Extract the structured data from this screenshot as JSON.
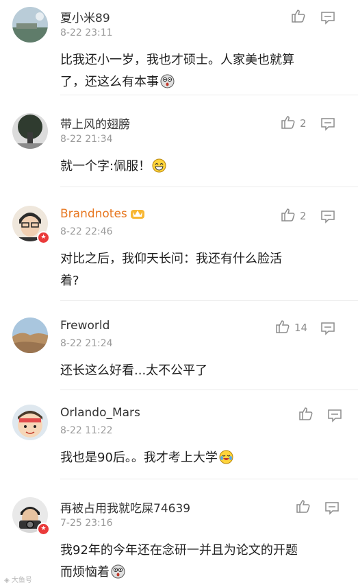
{
  "comments": [
    {
      "name": "夏小米89",
      "time": "8-22 23:11",
      "line1": "比我还小一岁，我也才硕士。人家美也就算",
      "line2": "了，还这么有本事",
      "likes": "",
      "verified": false
    },
    {
      "name": "带上风的翅膀",
      "time": "8-22 21:34",
      "line1": "就一个字:佩服！",
      "likes": "2",
      "verified": false
    },
    {
      "name": "Brandnotes",
      "time": "8-22 22:46",
      "line1": "对比之后，我仰天长问：我还有什么脸活",
      "line2": "着?",
      "likes": "2",
      "verified": true
    },
    {
      "name": "Freworld",
      "time": "8-22 21:24",
      "line1": "还长这么好看...太不公平了",
      "likes": "14",
      "verified": false
    },
    {
      "name": "Orlando_Mars",
      "time": "8-22 11:22",
      "line1": "我也是90后。。我才考上大学",
      "likes": "",
      "verified": false
    },
    {
      "name": "再被占用我就吃屎74639",
      "time": "7-25 23:16",
      "line1": "我92年的今年还在念研一并且为论文的开题",
      "line2": "而烦恼着",
      "likes": "",
      "verified": true
    }
  ],
  "watermark": "大鱼号",
  "icons": {
    "like": "thumbs-up-icon",
    "reply": "comment-icon",
    "verified": "verified-badge-icon"
  }
}
